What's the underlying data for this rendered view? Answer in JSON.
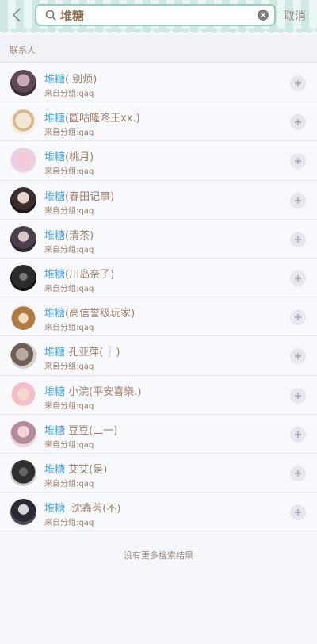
{
  "search": {
    "query": "堆糖",
    "cancel_label": "取消"
  },
  "section": {
    "title": "联系人"
  },
  "contacts": [
    {
      "keyword": "堆糖",
      "rest": "(.别烦)",
      "group": "来自分组:qaq"
    },
    {
      "keyword": "堆糖",
      "rest": "(圆咕隆咚王xx.)",
      "group": "来自分组:qaq"
    },
    {
      "keyword": "堆糖",
      "rest": "(桃月)",
      "group": "来自分组:qaq"
    },
    {
      "keyword": "堆糖",
      "rest": "(春田记事)",
      "group": "来自分组:qaq"
    },
    {
      "keyword": "堆糖",
      "rest": "(清茶)",
      "group": "来自分组:qaq"
    },
    {
      "keyword": "堆糖",
      "rest": "(川岛奈子)",
      "group": "来自分组:qaq"
    },
    {
      "keyword": "堆糖",
      "rest": "(高信誉级玩家)",
      "group": "来自分组:qaq"
    },
    {
      "keyword": "堆糖",
      "rest": " 孔亚萍(❕)",
      "group": "来自分组:qaq"
    },
    {
      "keyword": "堆糖",
      "rest": " 小浣(平安喜樂.)",
      "group": "来自分组:qaq"
    },
    {
      "keyword": "堆糖",
      "rest": " 豆豆(二一)",
      "group": "来自分组:qaq"
    },
    {
      "keyword": "堆糖",
      "rest": " 艾艾(是)",
      "group": "来自分组:qaq"
    },
    {
      "keyword": "堆糖",
      "rest": "  沈鑫芮(不)",
      "group": "来自分组:qaq"
    }
  ],
  "footer": {
    "text": "没有更多搜索结果"
  },
  "colors": {
    "keyword": "#4aa6d6",
    "text": "#9c7f6a",
    "header_stripe": "#cfe8e4",
    "search_border": "#9cc9c1"
  }
}
